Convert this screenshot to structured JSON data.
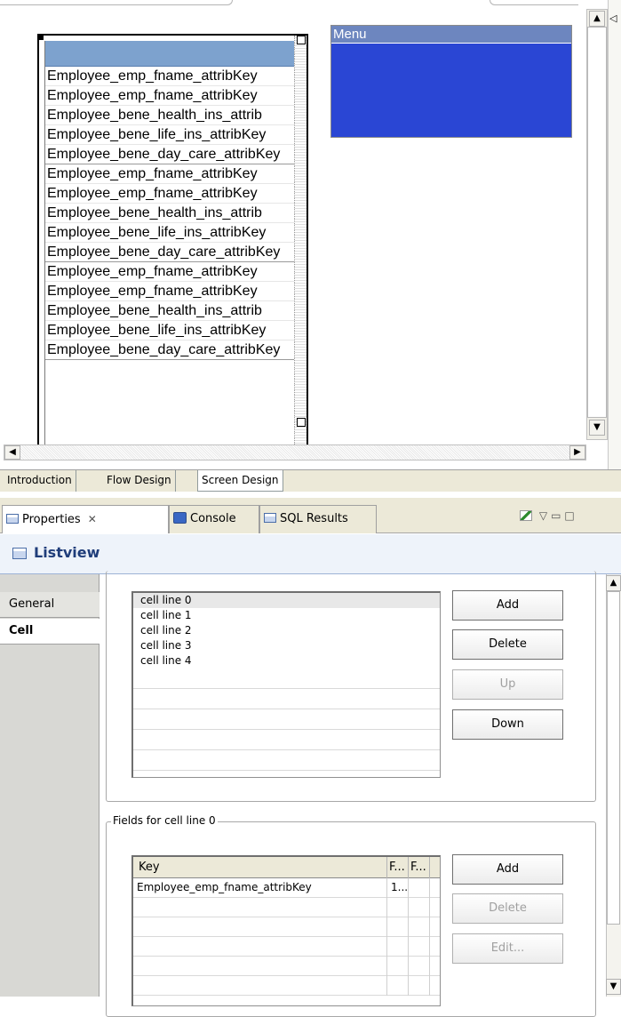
{
  "editor": {
    "listview": {
      "rows": [
        "Employee_emp_fname_attribKey",
        "Employee_emp_fname_attribKey",
        "Employee_bene_health_ins_attrib",
        "Employee_bene_life_ins_attribKey",
        "Employee_bene_day_care_attribKey",
        "Employee_emp_fname_attribKey",
        "Employee_emp_fname_attribKey",
        "Employee_bene_health_ins_attrib",
        "Employee_bene_life_ins_attribKey",
        "Employee_bene_day_care_attribKey",
        "Employee_emp_fname_attribKey",
        "Employee_emp_fname_attribKey",
        "Employee_bene_health_ins_attrib",
        "Employee_bene_life_ins_attribKey",
        "Employee_bene_day_care_attribKey"
      ]
    },
    "menu": {
      "title": "Menu"
    },
    "scroll_up": "▲",
    "scroll_down": "▼",
    "scroll_left": "◀",
    "scroll_right": "▶",
    "collapse_arrow": "◁"
  },
  "page_tabs": [
    "Introduction",
    "Flow Design",
    "Screen Design"
  ],
  "view_tabs": [
    {
      "label": "Properties",
      "icon": "properties-icon",
      "close": "✕"
    },
    {
      "label": "Console",
      "icon": "console-icon"
    },
    {
      "label": "SQL Results",
      "icon": "sql-results-icon"
    }
  ],
  "view_tools": {
    "menu": "▽",
    "minimize": "▭",
    "maximize": "□"
  },
  "properties": {
    "title": "Listview",
    "sections": [
      "General",
      "Cell"
    ],
    "cell_lines": {
      "items": [
        "cell line 0",
        "cell line 1",
        "cell line 2",
        "cell line 3",
        "cell line 4"
      ],
      "buttons": {
        "add": "Add",
        "delete": "Delete",
        "up": "Up",
        "down": "Down"
      }
    },
    "fields": {
      "legend": "Fields for cell line 0",
      "columns": [
        "Key",
        "F...",
        "F..."
      ],
      "rows": [
        [
          "Employee_emp_fname_attribKey",
          "1...",
          ""
        ]
      ],
      "buttons": {
        "add": "Add",
        "delete": "Delete",
        "edit": "Edit..."
      }
    }
  },
  "colors": {
    "menu_bg": "#2a46d4",
    "menu_title_bg": "#6d86bf",
    "listview_header": "#7da2ce",
    "title_text": "#1f3d7a"
  }
}
